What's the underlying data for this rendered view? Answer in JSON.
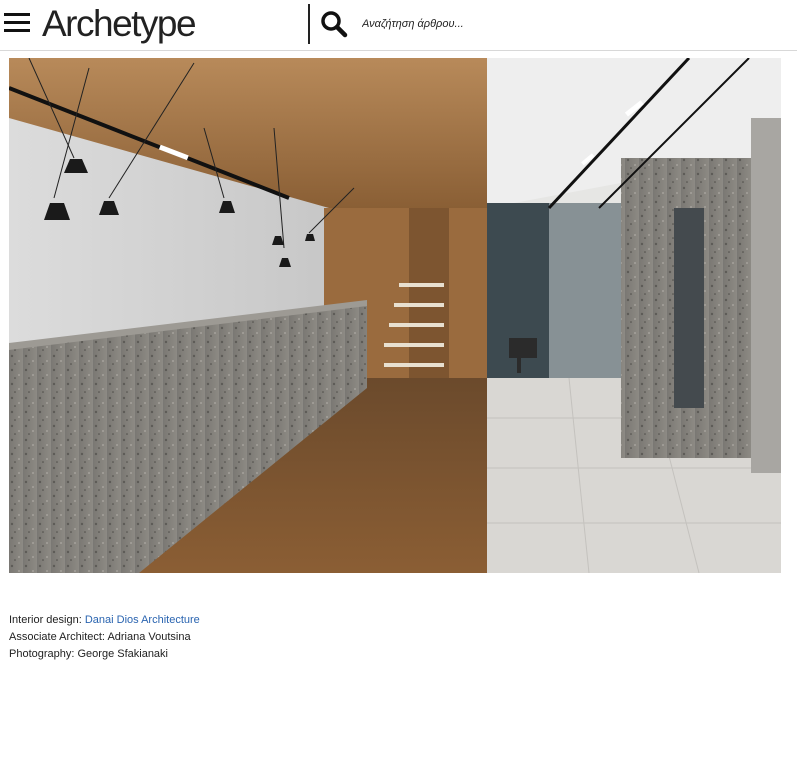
{
  "header": {
    "logo": "Archetype",
    "search_placeholder": "Αναζήτηση άρθρου..."
  },
  "article": {
    "photo_icon": "interior-photo",
    "credits": [
      {
        "label": "Interior design: ",
        "value": "Danai Dios Architecture",
        "is_link": true
      },
      {
        "label": "Associate Architect: ",
        "value": "Adriana Voutsina",
        "is_link": false
      },
      {
        "label": "Photography: ",
        "value": "George Sfakianaki",
        "is_link": false
      }
    ]
  },
  "colors": {
    "link": "#2a64b0",
    "text": "#222222"
  }
}
